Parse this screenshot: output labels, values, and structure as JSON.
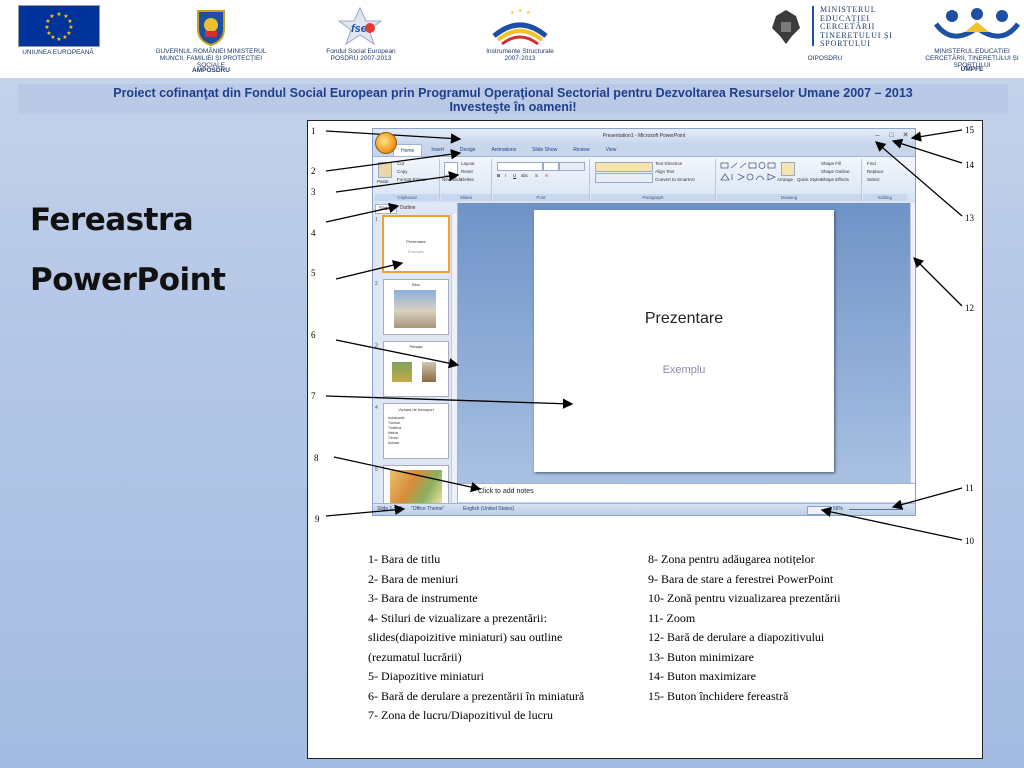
{
  "header": {
    "logos": [
      {
        "caption": "UNIUNEA EUROPEANĂ"
      },
      {
        "caption": "GUVERNUL ROMÂNIEI MINISTERUL MUNCII, FAMILIEI ȘI PROTECȚIEI SOCIALE",
        "caption2": "AMPOSDRU"
      },
      {
        "caption": "Fondul Social European POSDRU 2007-2013"
      },
      {
        "caption": "Instrumente Structurale 2007-2013"
      },
      {
        "caption": "OIPOSDRU",
        "ministry": "MINISTERUL EDUCAȚIEI CERCETĂRII TINERETULUI ȘI SPORTULUI"
      },
      {
        "caption": "MINISTERUL EDUCAȚIEI CERCETĂRII, TINERETULUI ȘI SPORTULUI",
        "caption2": "UMPFE"
      }
    ],
    "banner": "Proiect cofinanţat din Fondul Social European prin Programul Operaţional Sectorial pentru Dezvoltarea Resurselor Umane 2007 – 2013",
    "banner2": "Investeşte în oameni!"
  },
  "side_title": {
    "line1": "Fereastra",
    "line2": "PowerPoint"
  },
  "window": {
    "title": "Presentation1 - Microsoft PowerPoint",
    "tabs": [
      "Home",
      "Insert",
      "Design",
      "Animations",
      "Slide Show",
      "Review",
      "View"
    ],
    "ribbon": {
      "clipboard": {
        "label": "Clipboard",
        "paste": "Paste",
        "cut": "Cut",
        "copy": "Copy",
        "format_painter": "Format Painter"
      },
      "slides": {
        "label": "Slides",
        "new_slide": "New Slide",
        "layout": "Layout",
        "reset": "Reset",
        "delete": "Delete"
      },
      "font": {
        "label": "Font"
      },
      "paragraph": {
        "label": "Paragraph",
        "text_direction": "Text Direction",
        "align_text": "Align Text",
        "convert": "Convert to SmartArt"
      },
      "drawing": {
        "label": "Drawing",
        "arrange": "Arrange",
        "quick_styles": "Quick Styles",
        "fill": "Shape Fill",
        "outline": "Shape Outline",
        "effects": "Shape Effects"
      },
      "editing": {
        "label": "Editing",
        "find": "Find",
        "replace": "Replace",
        "select": "Select"
      }
    },
    "panel_tabs": [
      "Slides",
      "Outline"
    ],
    "thumbnails": [
      {
        "num": "1",
        "title": "Prezentare",
        "sub": "Exemplu"
      },
      {
        "num": "2",
        "title": "Bloc"
      },
      {
        "num": "3",
        "title": "Peisaje"
      },
      {
        "num": "4",
        "title": "Viziuea de transport",
        "bullets": [
          "Autobuzele",
          "Tramvai",
          "Troleibuz",
          "Metrou",
          "Trenuri",
          "Autocar"
        ]
      },
      {
        "num": "5"
      }
    ],
    "slide": {
      "title": "Prezentare",
      "subtitle": "Exemplu"
    },
    "notes_placeholder": "Click to add notes",
    "status": {
      "slide": "Slide 1 of 6",
      "theme": "\"Office Theme\"",
      "language": "English (United States)",
      "zoom": "56%"
    }
  },
  "callouts": [
    "1",
    "2",
    "3",
    "4",
    "5",
    "6",
    "7",
    "8",
    "9",
    "10",
    "11",
    "12",
    "13",
    "14",
    "15"
  ],
  "legend_left": [
    "1- Bara de titlu",
    "2- Bara de meniuri",
    "3- Bara de instrumente",
    "4- Stiluri de vizualizare a prezentării:",
    "slides(diapoizitive miniaturi) sau outline",
    "(rezumatul lucrării)",
    "5- Diapozitive miniaturi",
    "6- Bară de derulare a prezentării în  miniatură",
    "7- Zona de lucru/Diapozitivul de lucru"
  ],
  "legend_right": [
    "8- Zona pentru adăugarea notițelor",
    "9- Bara de stare a ferestrei PowerPoint",
    "10- Zonă pentru vizualizarea prezentării",
    "11- Zoom",
    "12- Bară de derulare a diapozitivului",
    "13- Buton minimizare",
    "14- Buton maximizare",
    "15- Buton închidere fereastră"
  ],
  "colors": {
    "banner_text": "#1f3f8c",
    "eu_blue": "#003399",
    "eu_yellow": "#ffcc00",
    "office_orange": "#f29b20"
  }
}
